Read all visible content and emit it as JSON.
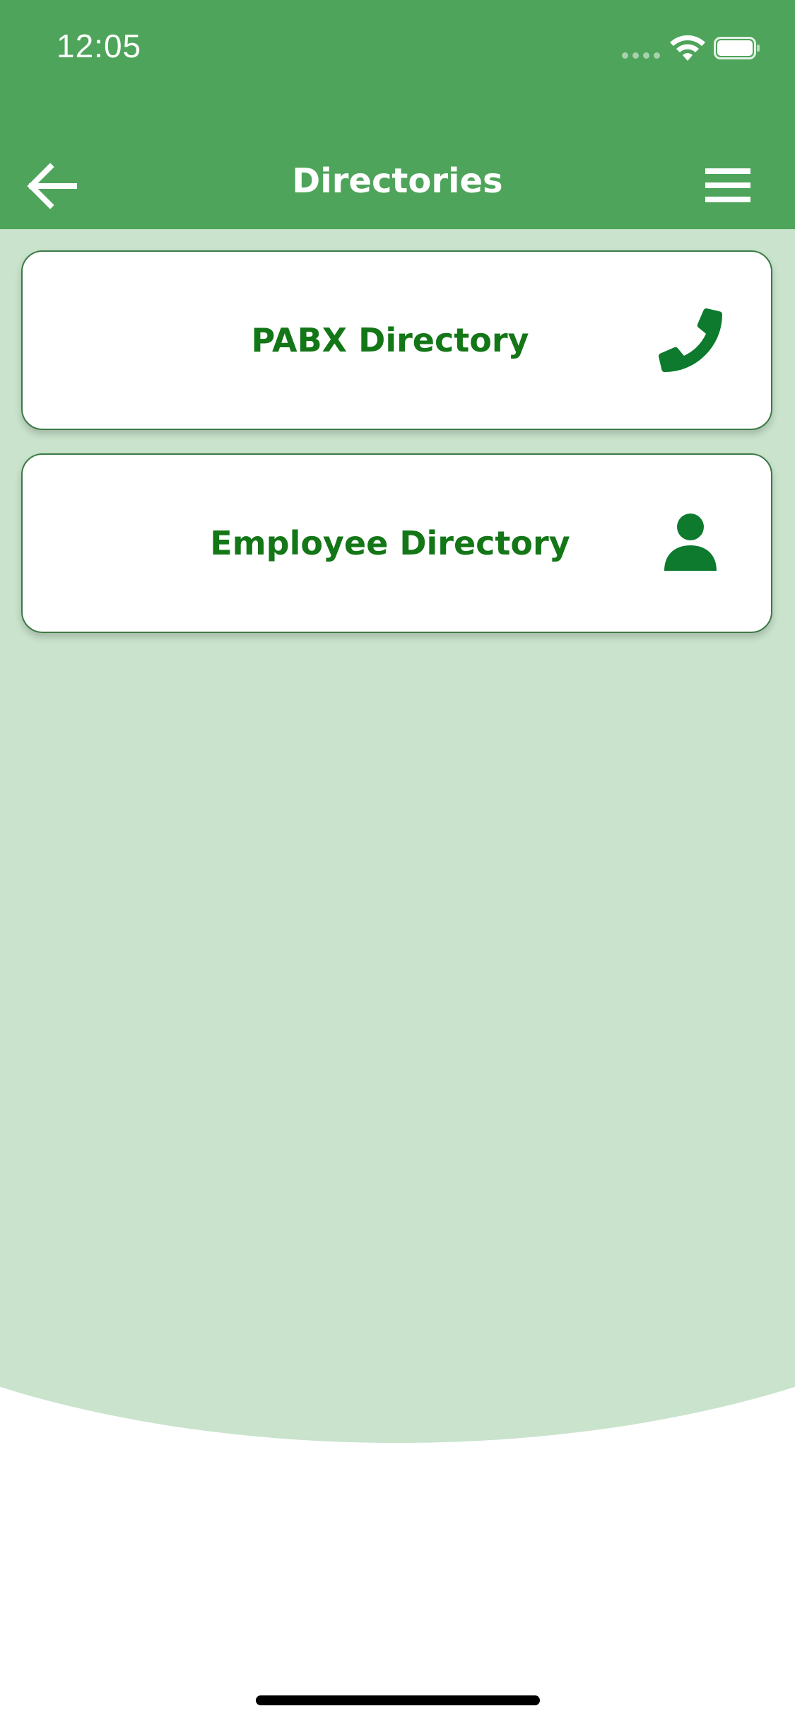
{
  "status_bar": {
    "time": "12:05"
  },
  "navbar": {
    "title": "Directories",
    "back_icon": "arrow-left-icon",
    "menu_icon": "hamburger-menu-icon"
  },
  "directories": [
    {
      "label": "PABX Directory",
      "icon": "phone-icon"
    },
    {
      "label": "Employee Directory",
      "icon": "person-icon"
    }
  ],
  "colors": {
    "header": "#4ea45a",
    "content_background": "#c9e3cd",
    "accent_text": "#137617",
    "icon": "#0d7a2e"
  }
}
